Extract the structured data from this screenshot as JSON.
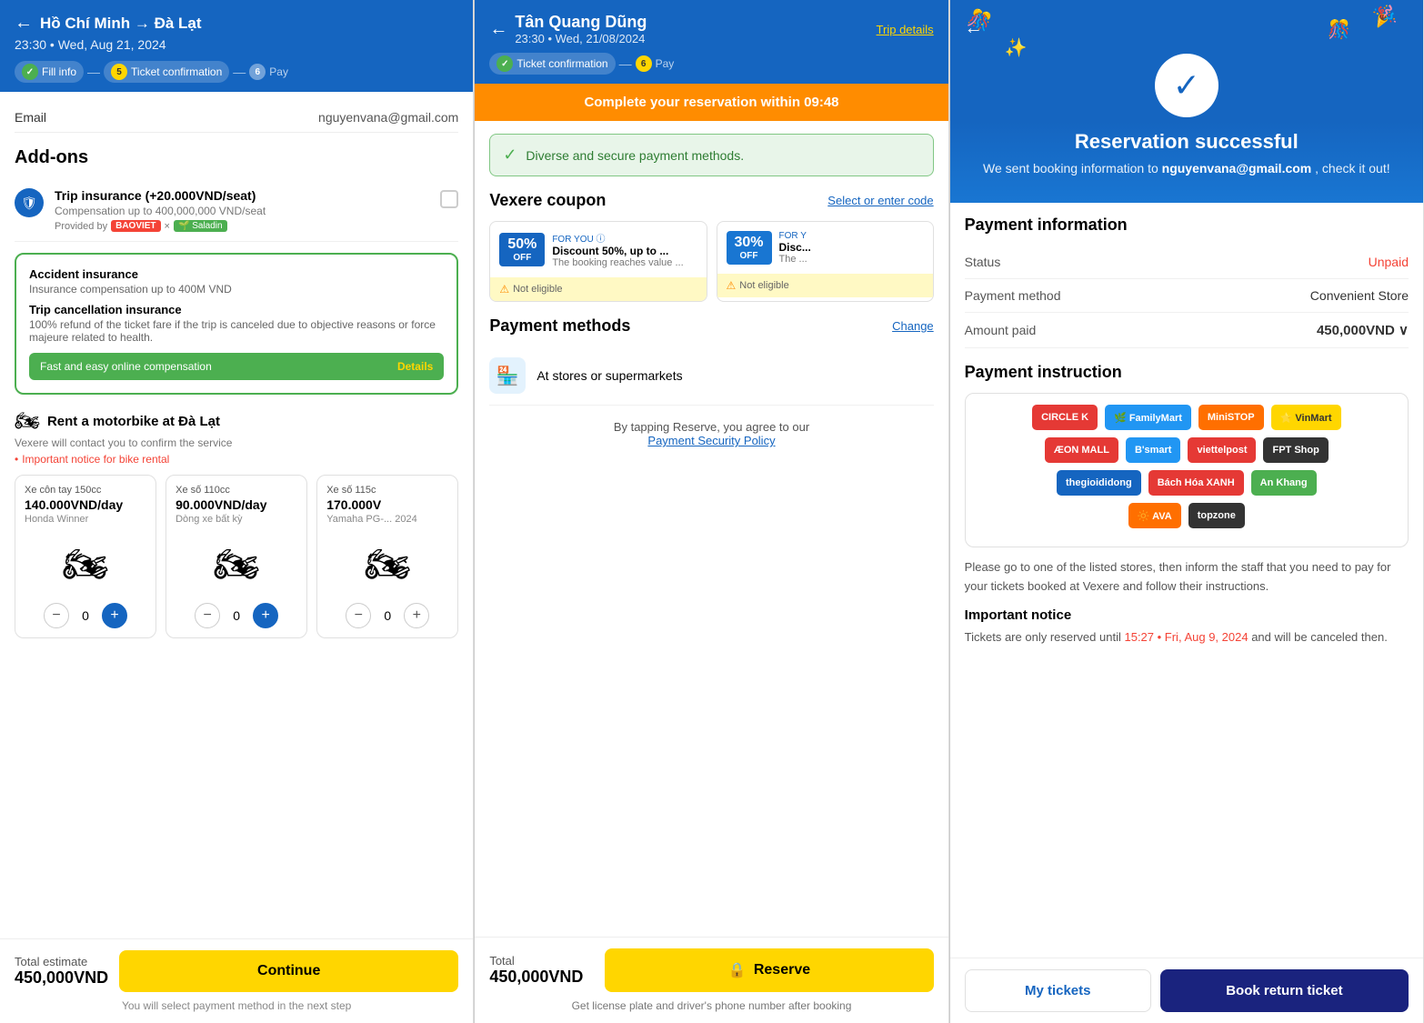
{
  "panel1": {
    "header": {
      "route": "Hồ Chí Minh → Đà Lạt",
      "datetime": "23:30 • Wed, Aug 21, 2024",
      "back_arrow": "←",
      "steps": [
        {
          "label": "Fill info",
          "type": "active",
          "icon": "✓"
        },
        {
          "label": "Ticket confirmation",
          "num": "5",
          "type": "current"
        },
        {
          "label": "Pay",
          "num": "6",
          "type": "inactive"
        }
      ]
    },
    "email": {
      "label": "Email",
      "value": "nguyenvana@gmail.com"
    },
    "addons_title": "Add-ons",
    "trip_insurance": {
      "name": "Trip insurance (+20.000VND/seat)",
      "compensation": "Compensation up to 400,000,000 VND/seat",
      "provider_label": "Provided by",
      "providers": [
        "BAOVIET",
        "×",
        "Saladin"
      ]
    },
    "insurance_box": {
      "items": [
        {
          "title": "Accident insurance",
          "desc": "Insurance compensation up to 400M VND"
        },
        {
          "title": "Trip cancellation insurance",
          "desc": "100% refund of the ticket fare if the trip is canceled due to objective reasons or force majeure related to health."
        }
      ],
      "footer_text": "Fast and easy online compensation",
      "footer_link": "Details"
    },
    "rental_title": "Rent a motorbike at Đà Lạt",
    "rental_sub": "Vexere will contact you to confirm the service",
    "rental_notice": "Important notice for bike rental",
    "bikes": [
      {
        "type": "Xe côn tay 150cc",
        "price": "140.000VND/day",
        "model": "Honda Winner",
        "count": 0
      },
      {
        "type": "Xe số 110cc",
        "price": "90.000VND/day",
        "model": "Dòng xe bất kỳ",
        "count": 0
      },
      {
        "type": "Xe số 115c",
        "price": "170.000V",
        "model": "Yamaha PG-... 2024",
        "count": 0
      }
    ],
    "footer": {
      "total_label": "Total estimate",
      "total_amount": "450,000VND",
      "continue_label": "Continue",
      "note": "You will select payment method in the next step"
    }
  },
  "panel2": {
    "header": {
      "name": "Tân Quang Dũng",
      "datetime": "23:30 • Wed, 21/08/2024",
      "trip_details": "Trip details",
      "back_arrow": "←",
      "steps": [
        {
          "label": "Ticket confirmation",
          "type": "active",
          "icon": "✓"
        },
        {
          "label": "Pay",
          "num": "6",
          "type": "inactive"
        }
      ]
    },
    "timer": {
      "text": "Complete your reservation within",
      "time": "09:48"
    },
    "secure_banner": {
      "icon": "✓",
      "text": "Diverse and secure payment methods."
    },
    "coupon_section": {
      "title": "Vexere coupon",
      "select_label": "Select or enter code",
      "coupons": [
        {
          "badge_pct": "50%",
          "badge_off": "OFF",
          "for_label": "FOR YOU ⓘ",
          "desc": "Discount 50%, up to ...",
          "sub": "The booking reaches value ...",
          "footer": "Not eligible",
          "badge_color": "blue"
        },
        {
          "badge_pct": "30%",
          "badge_off": "OFF",
          "for_label": "FOR Y",
          "desc": "Disc...",
          "sub": "The ...",
          "footer": "Not eligible",
          "badge_color": "blue"
        }
      ]
    },
    "payment_methods": {
      "title": "Payment methods",
      "change_label": "Change",
      "items": [
        {
          "icon": "🏪",
          "label": "At stores or supermarkets"
        }
      ]
    },
    "agree_text": "By tapping Reserve, you agree to our",
    "policy_link": "Payment Security Policy",
    "footer": {
      "total_label": "Total",
      "total_amount": "450,000VND",
      "reserve_label": "Reserve",
      "note": "Get license plate and driver's phone number after booking"
    }
  },
  "panel3": {
    "header": {
      "back_arrow": "←"
    },
    "celebration": {
      "check_icon": "✓",
      "title": "Reservation successful",
      "sub_text": "We sent booking information to",
      "email": "nguyenvana@gmail.com",
      "sub_text2": ", check it out!"
    },
    "payment_info": {
      "title": "Payment information",
      "rows": [
        {
          "label": "Status",
          "value": "Unpaid",
          "red": true
        },
        {
          "label": "Payment method",
          "value": "Convenient Store",
          "red": false
        },
        {
          "label": "Amount paid",
          "value": "450,000VND ∨",
          "red": false,
          "bold": true
        }
      ]
    },
    "payment_instruction": {
      "title": "Payment instruction",
      "stores": [
        {
          "name": "CIRCLE K",
          "class": "circle-k"
        },
        {
          "name": "FamilyMart",
          "class": "family-mart"
        },
        {
          "name": "MiniSTOP",
          "class": "mini-stop"
        },
        {
          "name": "VinMart",
          "class": "vin-mart"
        },
        {
          "name": "AEON MALL",
          "class": "aeon"
        },
        {
          "name": "B'smart",
          "class": "bsmart"
        },
        {
          "name": "viettelpost",
          "class": "viettel"
        },
        {
          "name": "FPT Shop",
          "class": "fpt"
        },
        {
          "name": "thegioididong",
          "class": "tgdd"
        },
        {
          "name": "Bách Hóa XANH",
          "class": "bach-hoa"
        },
        {
          "name": "An Khang",
          "class": "an-khang"
        },
        {
          "name": "AVA",
          "class": "ava"
        },
        {
          "name": "topzone",
          "class": "topzone"
        }
      ],
      "desc": "Please go to one of the listed stores, then inform the staff that you need to pay for your tickets booked at Vexere and follow their instructions.",
      "important_title": "Important notice",
      "notice_text_before": "Tickets are only reserved until",
      "notice_deadline": "15:27 • Fri, Aug 9, 2024",
      "notice_text_after": "and will be canceled then."
    },
    "footer": {
      "my_tickets": "My tickets",
      "book_return": "Book return ticket"
    }
  }
}
